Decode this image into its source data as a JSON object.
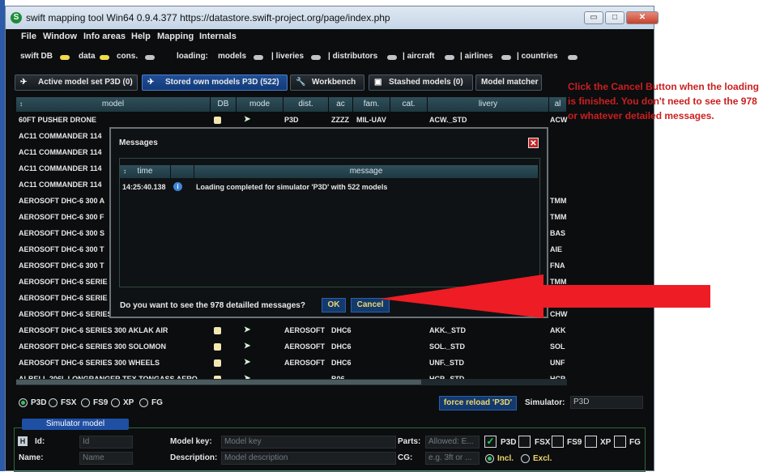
{
  "window": {
    "title": "swift mapping tool Win64 0.9.4.377 https://datastore.swift-project.org/page/index.php",
    "app_icon": "S",
    "min_glyph": "▭",
    "max_glyph": "□",
    "close_glyph": "✕"
  },
  "menu": [
    "File",
    "Window",
    "Info areas",
    "Help",
    "Mapping",
    "Internals"
  ],
  "status": {
    "swift_db": "swift DB",
    "data": "data",
    "cons": "cons.",
    "loading": "loading:",
    "items": [
      "models",
      "| liveries",
      "| distributors",
      "| aircraft",
      "| airlines",
      "| countries"
    ]
  },
  "tabs": [
    {
      "label": "Active model set P3D (0)",
      "icon": "airplane-icon"
    },
    {
      "label": "Stored own models P3D (522)",
      "icon": "airplane-icon"
    },
    {
      "label": "Workbench",
      "icon": "wrench-icon"
    },
    {
      "label": "Stashed models (0)",
      "icon": "database-icon"
    },
    {
      "label": "Model matcher",
      "icon": ""
    }
  ],
  "table": {
    "headers": [
      "model",
      "DB",
      "mode",
      "dist.",
      "ac",
      "fam.",
      "cat.",
      "livery",
      "al"
    ],
    "sort_icon": "↕",
    "rows": [
      {
        "model": "60FT PUSHER DRONE",
        "dist": "P3D",
        "ac": "ZZZZ",
        "fam": "MIL-UAV",
        "livery": "ACW._STD",
        "al": "ACW"
      },
      {
        "model": "AC11 COMMANDER 114",
        "dist": "",
        "ac": "",
        "fam": "",
        "livery": "",
        "al": ""
      },
      {
        "model": "AC11 COMMANDER 114",
        "dist": "",
        "ac": "",
        "fam": "",
        "livery": "",
        "al": ""
      },
      {
        "model": "AC11 COMMANDER 114",
        "dist": "",
        "ac": "",
        "fam": "",
        "livery": "",
        "al": ""
      },
      {
        "model": "AC11 COMMANDER 114",
        "dist": "",
        "ac": "",
        "fam": "",
        "livery": "",
        "al": ""
      },
      {
        "model": "AEROSOFT DHC-6 300 A",
        "dist": "",
        "ac": "",
        "fam": "",
        "livery": "",
        "al": "TMM"
      },
      {
        "model": "AEROSOFT DHC-6 300 F",
        "dist": "",
        "ac": "",
        "fam": "",
        "livery": "",
        "al": "TMM"
      },
      {
        "model": "AEROSOFT DHC-6 300 S",
        "dist": "",
        "ac": "",
        "fam": "",
        "livery": "",
        "al": "BAS"
      },
      {
        "model": "AEROSOFT DHC-6 300 T",
        "dist": "",
        "ac": "",
        "fam": "",
        "livery": "",
        "al": "AIE"
      },
      {
        "model": "AEROSOFT DHC-6 300 T",
        "dist": "",
        "ac": "",
        "fam": "",
        "livery": "",
        "al": "FNA"
      },
      {
        "model": "AEROSOFT DHC-6 SERIE",
        "dist": "",
        "ac": "",
        "fam": "",
        "livery": "",
        "al": "TMM"
      },
      {
        "model": "AEROSOFT DHC-6 SERIE",
        "dist": "",
        "ac": "",
        "fam": "",
        "livery": "",
        "al": ""
      },
      {
        "model": "AEROSOFT DHC-6 SERIES 300 WHEELS FAX",
        "dist": "AEROSOFT",
        "ac": "DHC6",
        "fam": "",
        "livery": "CHW._STD",
        "al": "CHW"
      },
      {
        "model": "AEROSOFT DHC-6 SERIES 300 AKLAK AIR",
        "dist": "AEROSOFT",
        "ac": "DHC6",
        "fam": "",
        "livery": "AKK._STD",
        "al": "AKK"
      },
      {
        "model": "AEROSOFT DHC-6 SERIES 300 SOLOMON",
        "dist": "AEROSOFT",
        "ac": "DHC6",
        "fam": "",
        "livery": "SOL._STD",
        "al": "SOL"
      },
      {
        "model": "AEROSOFT DHC-6 SERIES 300 WHEELS",
        "dist": "AEROSOFT",
        "ac": "DHC6",
        "fam": "",
        "livery": "UNF._STD",
        "al": "UNF"
      },
      {
        "model": "ALBELL 206L LONGRANGER TEX TONGASS AERO",
        "dist": "",
        "ac": "B06",
        "fam": "",
        "livery": "HCP._STD",
        "al": "HCP"
      }
    ]
  },
  "dialog": {
    "title": "Messages",
    "close_glyph": "✕",
    "headers": {
      "time": "time",
      "message": "message"
    },
    "message_time": "14:25:40.138",
    "message_text": "Loading completed for simulator 'P3D' with 522 models",
    "info_icon": "i",
    "question": "Do you want to see the 978 detailled messages?",
    "ok": "OK",
    "cancel": "Cancel"
  },
  "simulators": {
    "options": [
      "P3D",
      "FSX",
      "FS9",
      "XP",
      "FG"
    ],
    "selected": "P3D",
    "force_reload": "force reload 'P3D'",
    "simulator_label": "Simulator:",
    "simulator_value": "P3D"
  },
  "model_form": {
    "section": "Simulator model",
    "id_label": "Id:",
    "id_placeholder": "Id",
    "name_label": "Name:",
    "name_placeholder": "Name",
    "model_key_label": "Model key:",
    "model_key_placeholder": "Model key",
    "description_label": "Description:",
    "description_placeholder": "Model description",
    "parts_label": "Parts:",
    "parts_placeholder": "Allowed: E...",
    "cg_label": "CG:",
    "cg_placeholder": "e.g. 3ft or ...",
    "sim_checks": [
      "P3D",
      "FSX",
      "FS9",
      "XP",
      "FG"
    ],
    "checked": "P3D",
    "incl": "Incl.",
    "excl": "Excl."
  },
  "annotation": {
    "text": "Click the Cancel Button when the loading is finished.  You don't need to see the 978 or whatever detailed messages.",
    "color": "#cc1f1f",
    "arrow_color": "#ee1c25"
  }
}
